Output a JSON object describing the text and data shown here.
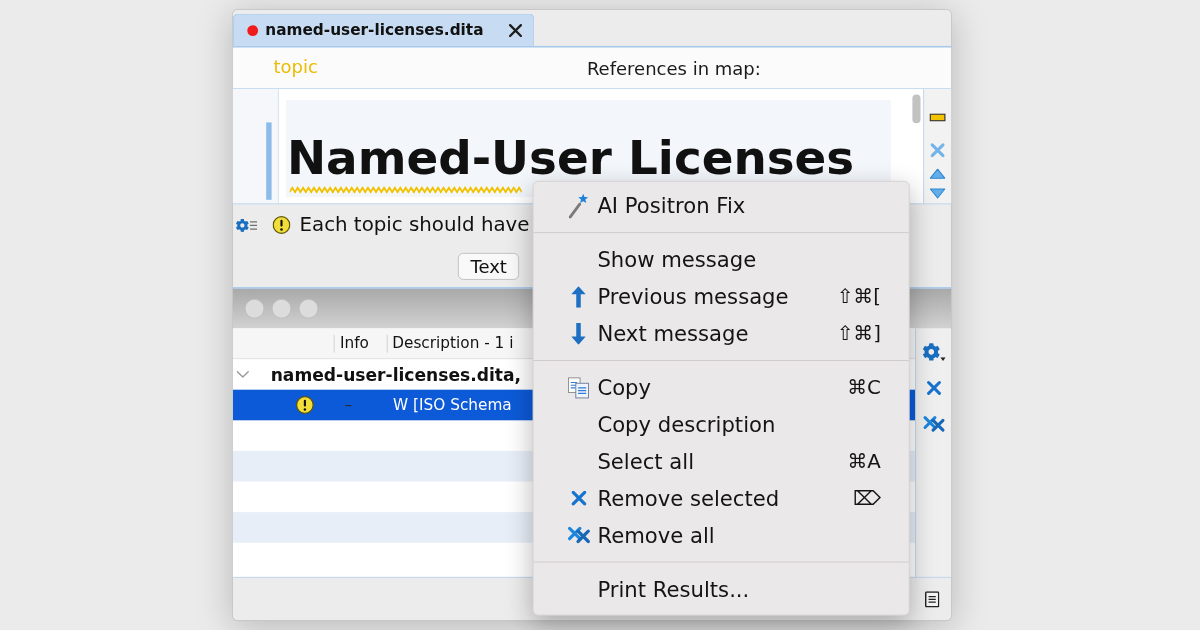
{
  "editor": {
    "tab": {
      "title": "named-user-licenses.dita",
      "modified": true
    },
    "breadcrumb": "topic",
    "references": "References in map:",
    "title": "Named-User Licenses",
    "title_warning": true,
    "message": "Each topic should have",
    "mode_tabs": [
      {
        "label": "Text",
        "selected": true
      }
    ]
  },
  "results": {
    "columns": [
      "Info",
      "Description - 1 i"
    ],
    "group": {
      "label": "named-user-licenses.dita,",
      "expanded": true
    },
    "rows": [
      {
        "info": "–",
        "description": "W [ISO Schema",
        "selected": true
      }
    ]
  },
  "context_menu": {
    "groups": [
      [
        {
          "label": "AI Positron Fix"
        }
      ],
      [
        {
          "label": "Show message"
        },
        {
          "label": "Previous message",
          "shortcut": "⇧⌘["
        },
        {
          "label": "Next message",
          "shortcut": "⇧⌘]"
        }
      ],
      [
        {
          "label": "Copy",
          "shortcut": "⌘C"
        },
        {
          "label": "Copy description"
        },
        {
          "label": "Select all",
          "shortcut": "⌘A"
        },
        {
          "label": "Remove selected",
          "shortcut": "⌦"
        },
        {
          "label": "Remove all"
        }
      ],
      [
        {
          "label": "Print Results..."
        }
      ]
    ]
  }
}
